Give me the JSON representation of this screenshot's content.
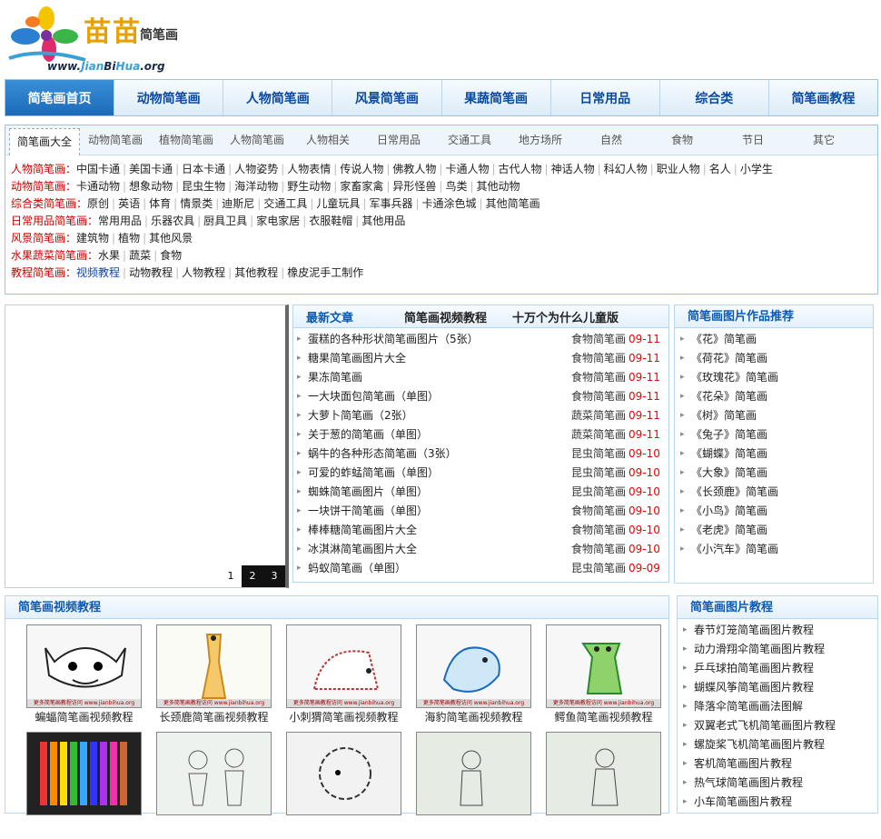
{
  "logo": {
    "title": "苗苗",
    "subtitle": "简笔画",
    "url_prefix": "www.",
    "url_hl1": "Jian",
    "url_mid": "Bi",
    "url_hl2": "Hua",
    "url_suffix": ".org"
  },
  "nav": [
    "简笔画首页",
    "动物简笔画",
    "人物简笔画",
    "风景简笔画",
    "果蔬简笔画",
    "日常用品",
    "综合类",
    "简笔画教程"
  ],
  "cat_tabs": [
    "简笔画大全",
    "动物简笔画",
    "植物简笔画",
    "人物简笔画",
    "人物相关",
    "日常用品",
    "交通工具",
    "地方场所",
    "自然",
    "食物",
    "节日",
    "其它"
  ],
  "cat_rows": [
    {
      "label": "人物简笔画：",
      "items": [
        "中国卡通",
        "美国卡通",
        "日本卡通",
        "人物姿势",
        "人物表情",
        "传说人物",
        "佛教人物",
        "卡通人物",
        "古代人物",
        "神话人物",
        "科幻人物",
        "职业人物",
        "名人",
        "小学生"
      ]
    },
    {
      "label": "动物简笔画：",
      "items": [
        "卡通动物",
        "想象动物",
        "昆虫生物",
        "海洋动物",
        "野生动物",
        "家畜家禽",
        "异形怪兽",
        "鸟类",
        "其他动物"
      ]
    },
    {
      "label": "综合类简笔画：",
      "items": [
        "原创",
        "英语",
        "体育",
        "情景类",
        "迪斯尼",
        "交通工具",
        "儿童玩具",
        "军事兵器",
        "卡通涂色城",
        "其他简笔画"
      ]
    },
    {
      "label": "日常用品简笔画：",
      "items": [
        "常用用品",
        "乐器农具",
        "厨具卫具",
        "家电家居",
        "衣服鞋帽",
        "其他用品"
      ]
    },
    {
      "label": "风景简笔画：",
      "items": [
        "建筑物",
        "植物",
        "其他风景"
      ]
    },
    {
      "label": "水果蔬菜简笔画：",
      "items": [
        "水果",
        "蔬菜",
        "食物"
      ]
    },
    {
      "label": "教程简笔画：",
      "items": [
        "视频教程",
        "动物教程",
        "人物教程",
        "其他教程",
        "橡皮泥手工制作"
      ]
    }
  ],
  "slider": {
    "pages": [
      "1",
      "2",
      "3"
    ]
  },
  "news": {
    "tab_latest": "最新文章",
    "tab_video": "简笔画视频教程",
    "tab_why": "十万个为什么儿童版",
    "items": [
      {
        "title": "蛋糕的各种形状简笔画图片（5张）",
        "cat": "食物简笔画",
        "date": "09-11"
      },
      {
        "title": "糖果简笔画图片大全",
        "cat": "食物简笔画",
        "date": "09-11"
      },
      {
        "title": "果冻简笔画",
        "cat": "食物简笔画",
        "date": "09-11"
      },
      {
        "title": "一大块面包简笔画（单图）",
        "cat": "食物简笔画",
        "date": "09-11"
      },
      {
        "title": "大萝卜简笔画（2张）",
        "cat": "蔬菜简笔画",
        "date": "09-11"
      },
      {
        "title": "关于葱的简笔画（单图）",
        "cat": "蔬菜简笔画",
        "date": "09-11"
      },
      {
        "title": "蜗牛的各种形态简笔画（3张）",
        "cat": "昆虫简笔画",
        "date": "09-10"
      },
      {
        "title": "可爱的蚱蜢简笔画（单图）",
        "cat": "昆虫简笔画",
        "date": "09-10"
      },
      {
        "title": "蜘蛛简笔画图片（单图）",
        "cat": "昆虫简笔画",
        "date": "09-10"
      },
      {
        "title": "一块饼干简笔画（单图）",
        "cat": "食物简笔画",
        "date": "09-10"
      },
      {
        "title": "棒棒糖简笔画图片大全",
        "cat": "食物简笔画",
        "date": "09-10"
      },
      {
        "title": "冰淇淋简笔画图片大全",
        "cat": "食物简笔画",
        "date": "09-10"
      },
      {
        "title": "蚂蚁简笔画（单图）",
        "cat": "昆虫简笔画",
        "date": "09-09"
      }
    ]
  },
  "recommend": {
    "title": "简笔画图片作品推荐",
    "items": [
      "《花》简笔画",
      "《荷花》简笔画",
      "《玫瑰花》简笔画",
      "《花朵》简笔画",
      "《树》简笔画",
      "《兔子》简笔画",
      "《蝴蝶》简笔画",
      "《大象》简笔画",
      "《长颈鹿》简笔画",
      "《小鸟》简笔画",
      "《老虎》简笔画",
      "《小汽车》简笔画"
    ]
  },
  "video": {
    "title": "简笔画视频教程",
    "thumb_caption": "更多简笔画教程访问 www.jianbihua.org",
    "items": [
      "蝙蝠简笔画视频教程",
      "长颈鹿简笔画视频教程",
      "小刺猬简笔画视频教程",
      "海豹简笔画视频教程",
      "鳄鱼简笔画视频教程",
      "",
      "",
      "",
      "",
      ""
    ]
  },
  "tutorial": {
    "title": "简笔画图片教程",
    "items": [
      "春节灯笼简笔画图片教程",
      "动力滑翔伞简笔画图片教程",
      "乒乓球拍简笔画图片教程",
      "蝴蝶风筝简笔画图片教程",
      "降落伞简笔画画法图解",
      "双翼老式飞机简笔画图片教程",
      "螺旋桨飞机简笔画图片教程",
      "客机简笔画图片教程",
      "热气球简笔画图片教程",
      "小车简笔画图片教程"
    ]
  }
}
